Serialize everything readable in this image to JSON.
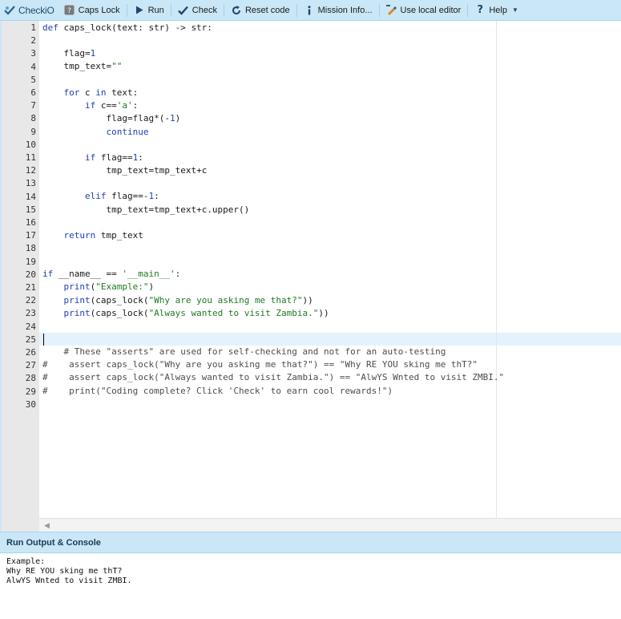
{
  "toolbar": {
    "logo": "CheckiO",
    "items": [
      {
        "label": "Caps Lock",
        "icon": "mission-icon"
      },
      {
        "label": "Run",
        "icon": "play-icon"
      },
      {
        "label": "Check",
        "icon": "check-icon"
      },
      {
        "label": "Reset code",
        "icon": "reset-icon"
      },
      {
        "label": "Mission Info...",
        "icon": "info-icon"
      },
      {
        "label": "Use local editor",
        "icon": "local-editor-icon"
      },
      {
        "label": "Help",
        "icon": "help-icon"
      }
    ]
  },
  "editor": {
    "line_numbers": [
      "1",
      "2",
      "3",
      "4",
      "5",
      "6",
      "7",
      "8",
      "9",
      "10",
      "11",
      "12",
      "13",
      "14",
      "15",
      "16",
      "17",
      "18",
      "19",
      "20",
      "21",
      "22",
      "23",
      "24",
      "25",
      "26",
      "27",
      "28",
      "29",
      "30"
    ],
    "active_line": "25"
  },
  "code": {
    "l1a": "def",
    "l1b": " caps_lock(text: str) -> str:",
    "l3": "flag=",
    "l3n": "1",
    "l4": "tmp_text=",
    "l4s": "\"\"",
    "l6a": "for",
    "l6b": " c ",
    "l6c": "in",
    "l6d": " text:",
    "l7a": "if",
    "l7b": " c==",
    "l7s": "'a'",
    "l7c": ":",
    "l8a": "flag=flag*(-",
    "l8n": "1",
    "l8b": ")",
    "l9": "continue",
    "l11a": "if",
    "l11b": " flag==",
    "l11n": "1",
    "l11c": ":",
    "l12": "tmp_text=tmp_text+c",
    "l14a": "elif",
    "l14b": " flag==-",
    "l14n": "1",
    "l14c": ":",
    "l15": "tmp_text=tmp_text+c.upper()",
    "l17a": "return",
    "l17b": " tmp_text",
    "l20a": "if",
    "l20b": " __name__ == ",
    "l20s": "'__main__'",
    "l20c": ":",
    "l21a": "print",
    "l21b": "(",
    "l21s": "\"Example:\"",
    "l21c": ")",
    "l22a": "print",
    "l22b": "(caps_lock(",
    "l22s": "\"Why are you asking me that?\"",
    "l22c": "))",
    "l23a": "print",
    "l23b": "(caps_lock(",
    "l23s": "\"Always wanted to visit Zambia.\"",
    "l23c": "))",
    "l26": "# These \"asserts\" are used for self-checking and not for an auto-testing",
    "l27": "#    assert caps_lock(\"Why are you asking me that?\") == \"Why RE YOU sking me thT?\"",
    "l28": "#    assert caps_lock(\"Always wanted to visit Zambia.\") == \"AlwYS Wnted to visit ZMBI.\"",
    "l29": "#    print(\"Coding complete? Click 'Check' to earn cool rewards!\")"
  },
  "console": {
    "title": "Run Output & Console",
    "lines": [
      "Example:",
      "Why RE YOU sking me thT?",
      "AlwYS Wnted to visit ZMBI."
    ]
  }
}
